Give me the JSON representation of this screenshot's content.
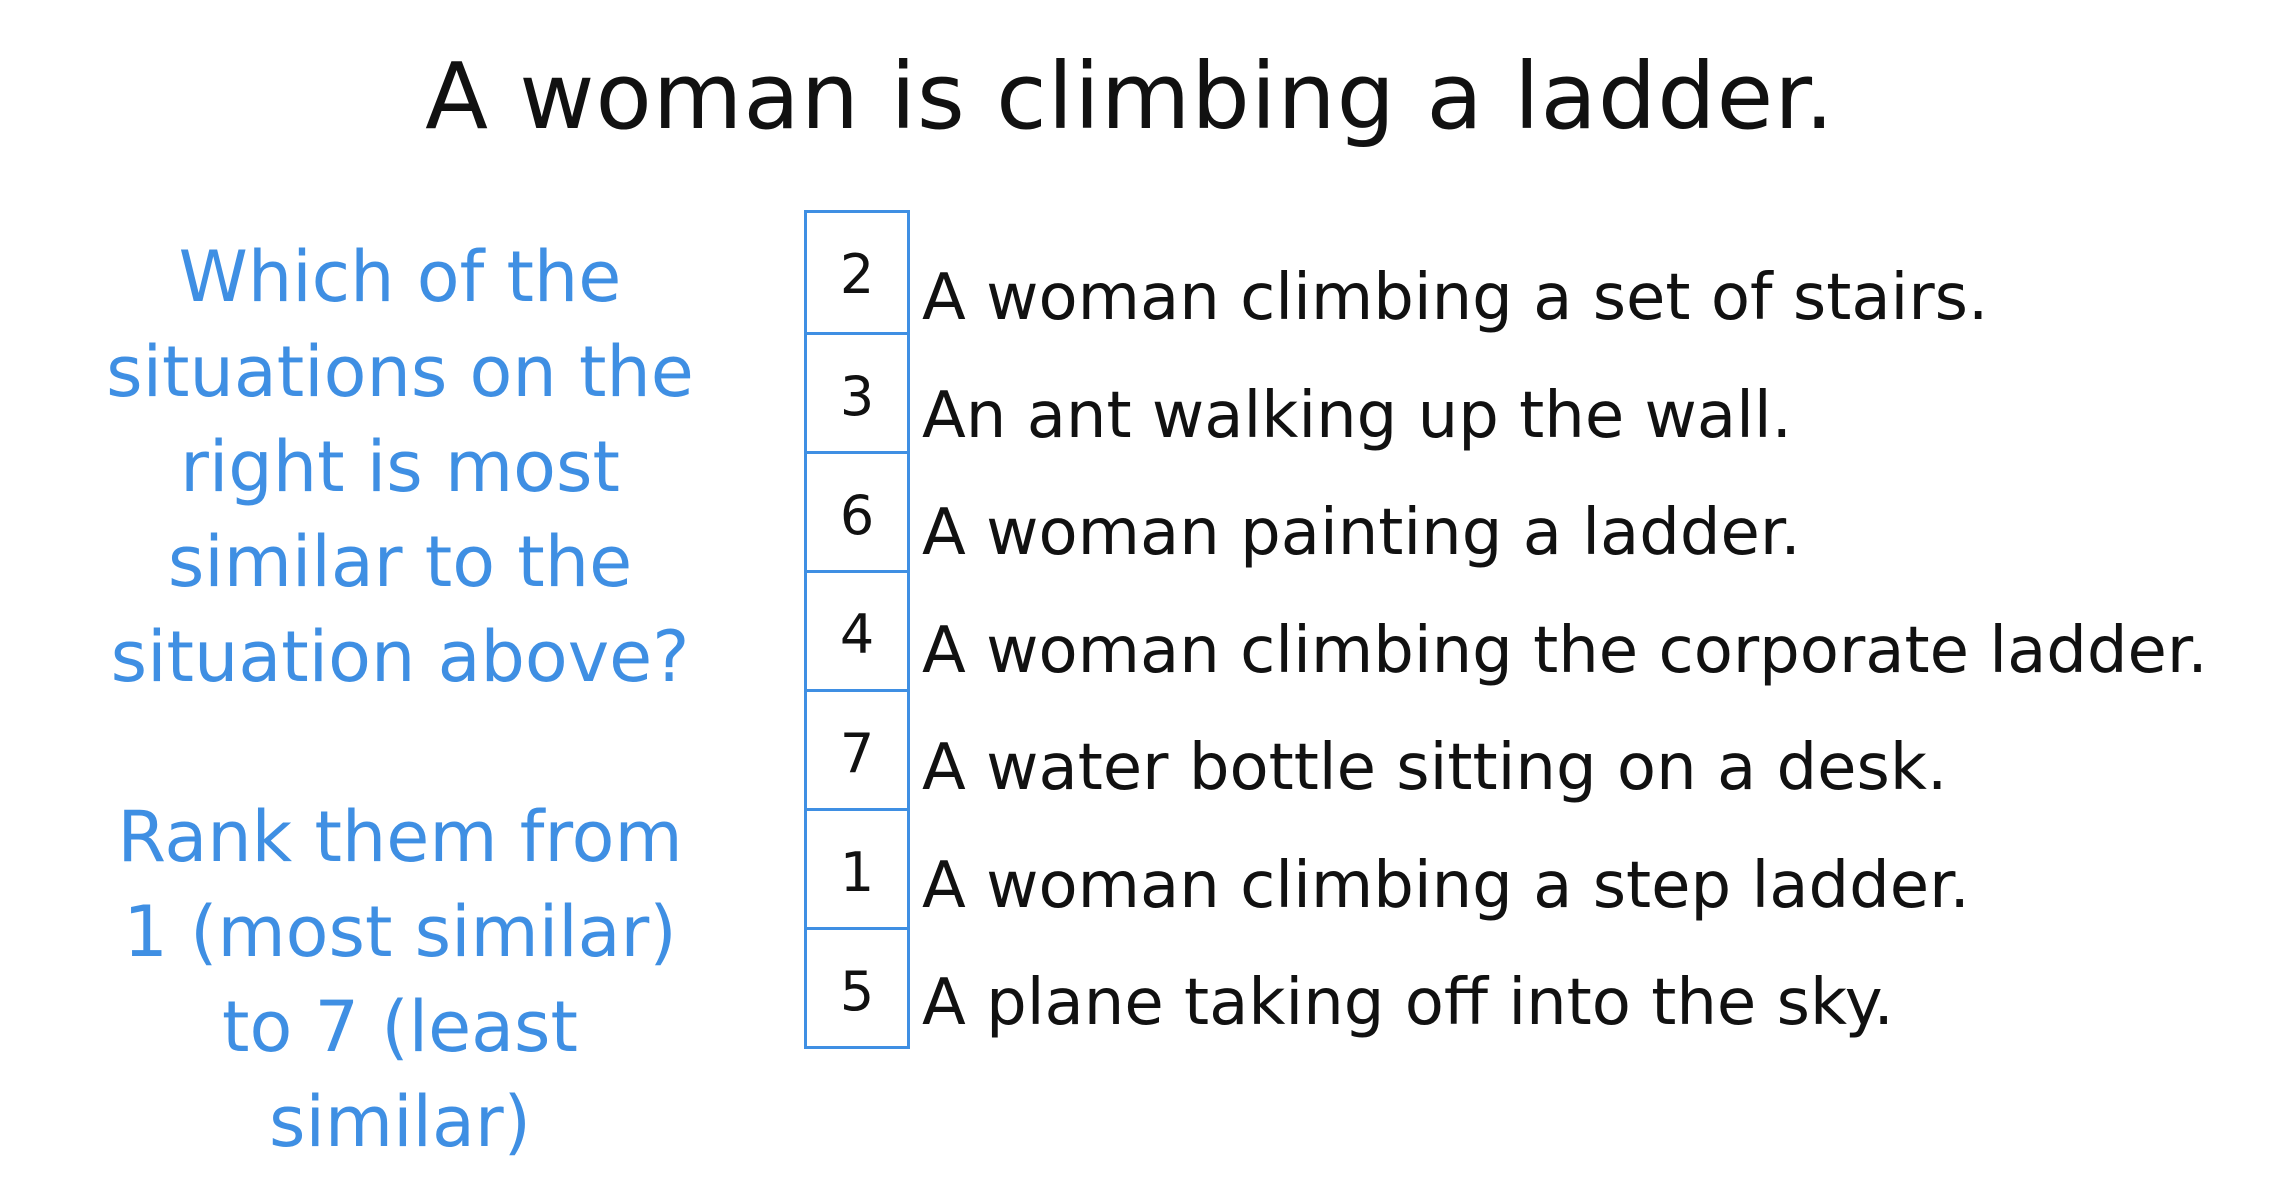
{
  "title": "A woman is climbing a ladder.",
  "question_lines": [
    "Which of the",
    "situations on the",
    "right is most",
    "similar to the",
    "situation above?"
  ],
  "rank_instruction_lines": [
    "Rank them from",
    "1 (most similar)",
    "to 7 (least",
    "similar)"
  ],
  "rankings": [
    "2",
    "3",
    "6",
    "4",
    "7",
    "1",
    "5"
  ],
  "situations": [
    "A woman climbing a set of stairs.",
    "An ant walking up the wall.",
    "A woman painting a ladder.",
    "A woman climbing the corporate ladder.",
    "A water bottle sitting on a desk.",
    "A woman climbing a step ladder.",
    "A plane taking off into the sky."
  ],
  "colors": {
    "accent": "#3f8fe3",
    "text": "#111111",
    "background": "#ffffff"
  }
}
